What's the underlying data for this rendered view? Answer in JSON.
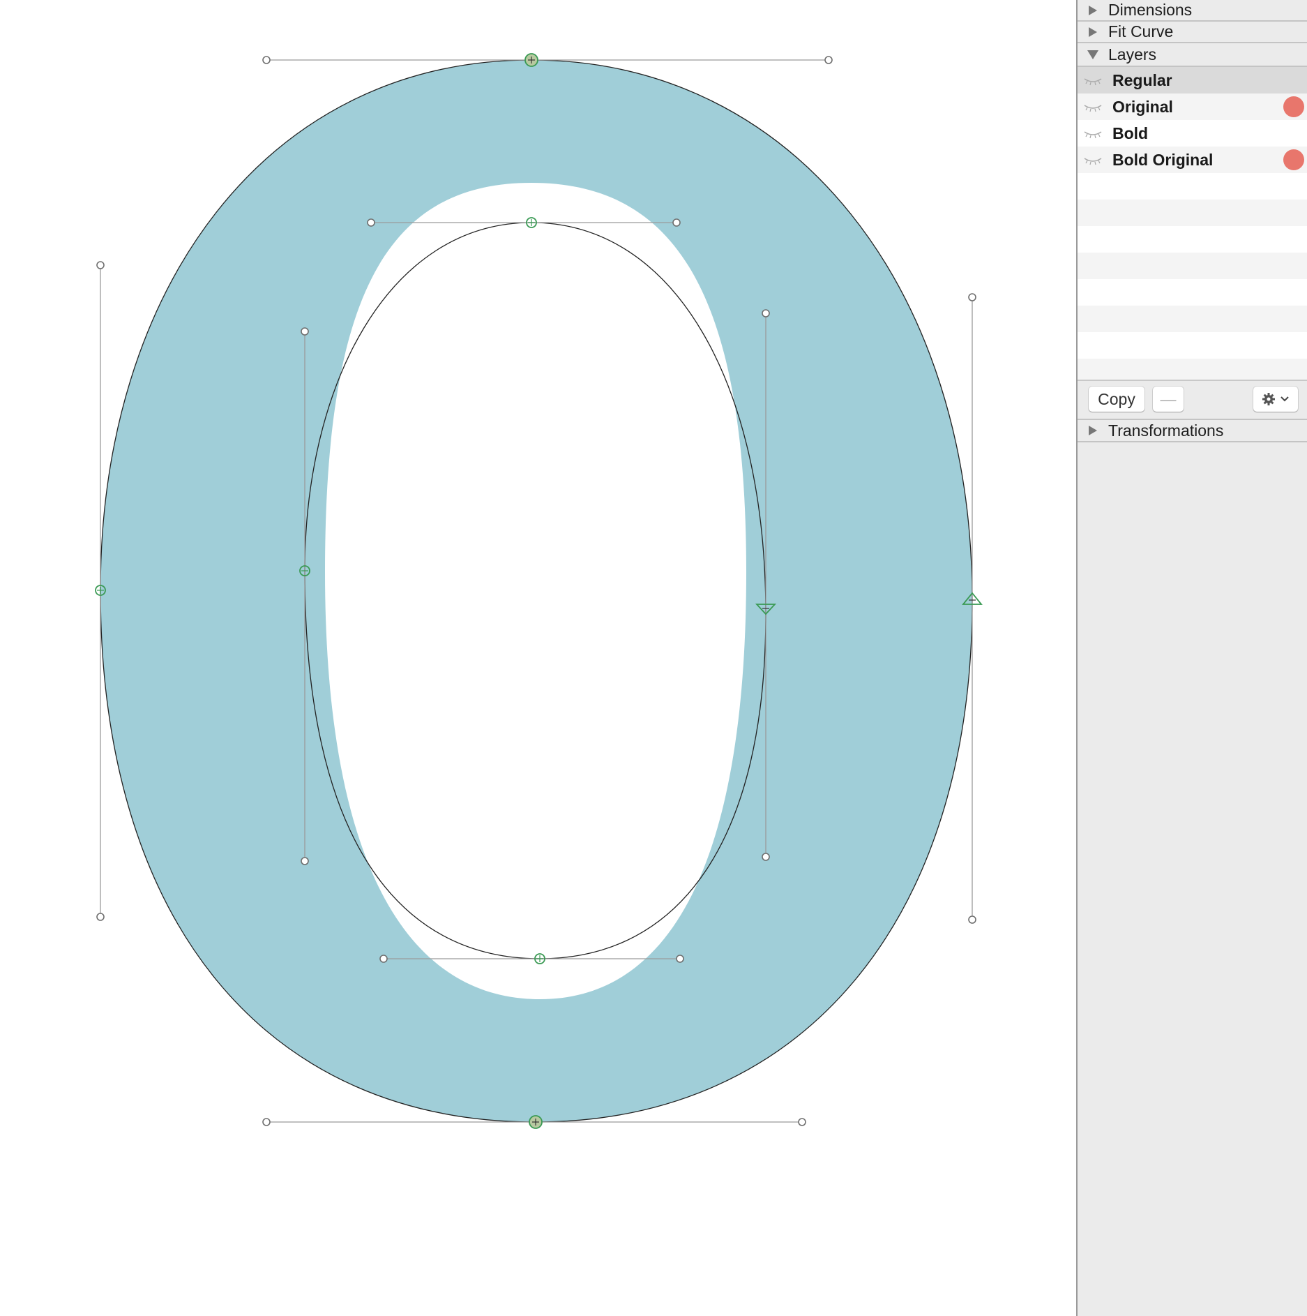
{
  "panel": {
    "sections": {
      "dimensions": "Dimensions",
      "fit_curve": "Fit Curve",
      "layers": "Layers",
      "transformations": "Transformations"
    },
    "layers": [
      {
        "name": "Regular",
        "selected": true,
        "marker": false
      },
      {
        "name": "Original",
        "selected": false,
        "marker": true
      },
      {
        "name": "Bold",
        "selected": false,
        "marker": false
      },
      {
        "name": "Bold Original",
        "selected": false,
        "marker": true
      }
    ],
    "buttons": {
      "copy": "Copy",
      "remove": "—"
    },
    "icons": {
      "eye": "eye-closed-icon",
      "gear": "gear-icon",
      "chevron": "chevron-down-icon",
      "disclosure_closed": "disclosure-triangle-right-icon",
      "disclosure_open": "disclosure-triangle-down-icon"
    },
    "colors": {
      "marker": "#e8766c",
      "selected_row": "#dadada"
    }
  },
  "canvas": {
    "glyph_fill": "#a0ced8",
    "node_color": "#3a9a54",
    "handle_color": "#8a8a8a"
  }
}
